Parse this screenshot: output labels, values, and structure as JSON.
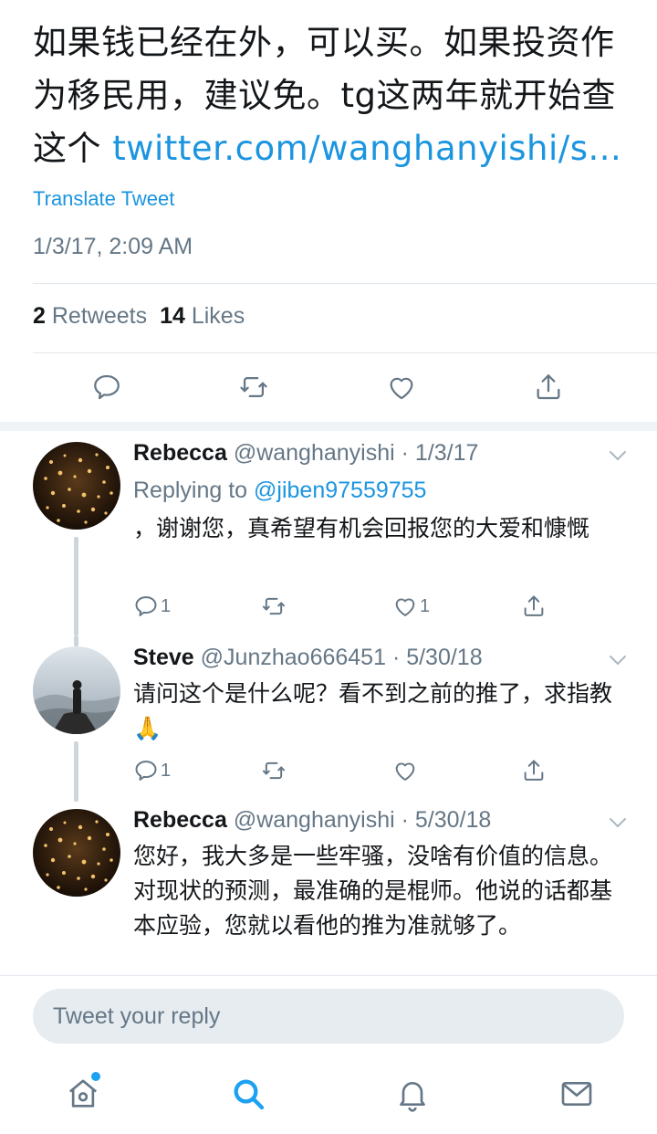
{
  "main_tweet": {
    "text": "如果钱已经在外，可以买。如果投资作为移民用，建议免。tg这两年就开始查这个 ",
    "link": "twitter.com/wanghanyishi/s...",
    "translate_label": "Translate Tweet",
    "timestamp": "1/3/17, 2:09 AM",
    "retweets_count": "2",
    "retweets_label": "Retweets",
    "likes_count": "14",
    "likes_label": "Likes"
  },
  "icons": {
    "reply": "reply-icon",
    "retweet": "retweet-icon",
    "like": "heart-icon",
    "share": "share-icon",
    "chevron": "chevron-down-icon",
    "home": "home-icon",
    "search": "search-icon",
    "notifications": "bell-icon",
    "messages": "mail-icon"
  },
  "colors": {
    "accent": "#1b95e0",
    "muted": "#657786",
    "text": "#14171a",
    "input_bg": "#e6ecf0"
  },
  "replies": [
    {
      "name": "Rebecca",
      "meta": "@wanghanyishi · 1/3/17",
      "replying_prefix": "Replying to",
      "replying_handle": "@jiben97559755",
      "text": "，谢谢您，真希望有机会回报您的大爱和慷慨",
      "reply_count": "1",
      "like_count": "1"
    },
    {
      "name": "Steve",
      "meta": "@Junzhao666451 · 5/30/18",
      "text": "请问这个是什么呢？看不到之前的推了，求指教🙏",
      "reply_count": "1",
      "like_count": ""
    },
    {
      "name": "Rebecca",
      "meta": "@wanghanyishi · 5/30/18",
      "text": "您好，我大多是一些牢骚，没啥有价值的信息。对现状的预测，最准确的是棍师。他说的话都基本应验，您就以看他的推为准就够了。"
    }
  ],
  "compose": {
    "placeholder": "Tweet your reply"
  }
}
